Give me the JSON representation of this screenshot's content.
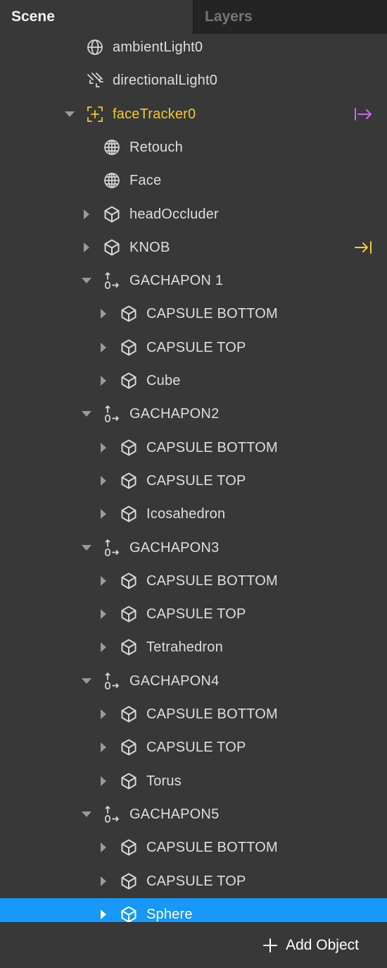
{
  "tabs": {
    "scene": "Scene",
    "layers": "Layers"
  },
  "tree": [
    {
      "label": "ambientLight0",
      "icon": "ambient-light-icon",
      "depth": 2,
      "expander": "none"
    },
    {
      "label": "directionalLight0",
      "icon": "directional-light-icon",
      "depth": 2,
      "expander": "none"
    },
    {
      "label": "faceTracker0",
      "icon": "face-tracker-icon",
      "depth": 2,
      "expander": "expanded",
      "accent": "yellow",
      "badge": "patch-out-icon",
      "badge_color": "#c86ae0"
    },
    {
      "label": "Retouch",
      "icon": "mesh-icon",
      "depth": 3,
      "expander": "none"
    },
    {
      "label": "Face",
      "icon": "mesh-icon",
      "depth": 3,
      "expander": "none"
    },
    {
      "label": "headOccluder",
      "icon": "cube-icon",
      "depth": 3,
      "expander": "collapsed"
    },
    {
      "label": "KNOB",
      "icon": "cube-icon",
      "depth": 3,
      "expander": "collapsed",
      "badge": "patch-in-icon",
      "badge_color": "#f4c63d"
    },
    {
      "label": "GACHAPON 1",
      "icon": "null-object-icon",
      "depth": 3,
      "expander": "expanded"
    },
    {
      "label": "CAPSULE BOTTOM",
      "icon": "cube-icon",
      "depth": 4,
      "expander": "collapsed"
    },
    {
      "label": "CAPSULE TOP",
      "icon": "cube-icon",
      "depth": 4,
      "expander": "collapsed"
    },
    {
      "label": "Cube",
      "icon": "cube-icon",
      "depth": 4,
      "expander": "collapsed"
    },
    {
      "label": "GACHAPON2",
      "icon": "null-object-icon",
      "depth": 3,
      "expander": "expanded"
    },
    {
      "label": "CAPSULE BOTTOM",
      "icon": "cube-icon",
      "depth": 4,
      "expander": "collapsed"
    },
    {
      "label": "CAPSULE TOP",
      "icon": "cube-icon",
      "depth": 4,
      "expander": "collapsed"
    },
    {
      "label": "Icosahedron",
      "icon": "cube-icon",
      "depth": 4,
      "expander": "collapsed"
    },
    {
      "label": "GACHAPON3",
      "icon": "null-object-icon",
      "depth": 3,
      "expander": "expanded"
    },
    {
      "label": "CAPSULE BOTTOM",
      "icon": "cube-icon",
      "depth": 4,
      "expander": "collapsed"
    },
    {
      "label": "CAPSULE TOP",
      "icon": "cube-icon",
      "depth": 4,
      "expander": "collapsed"
    },
    {
      "label": "Tetrahedron",
      "icon": "cube-icon",
      "depth": 4,
      "expander": "collapsed"
    },
    {
      "label": "GACHAPON4",
      "icon": "null-object-icon",
      "depth": 3,
      "expander": "expanded"
    },
    {
      "label": "CAPSULE BOTTOM",
      "icon": "cube-icon",
      "depth": 4,
      "expander": "collapsed"
    },
    {
      "label": "CAPSULE TOP",
      "icon": "cube-icon",
      "depth": 4,
      "expander": "collapsed"
    },
    {
      "label": "Torus",
      "icon": "cube-icon",
      "depth": 4,
      "expander": "collapsed"
    },
    {
      "label": "GACHAPON5",
      "icon": "null-object-icon",
      "depth": 3,
      "expander": "expanded"
    },
    {
      "label": "CAPSULE BOTTOM",
      "icon": "cube-icon",
      "depth": 4,
      "expander": "collapsed"
    },
    {
      "label": "CAPSULE TOP",
      "icon": "cube-icon",
      "depth": 4,
      "expander": "collapsed"
    },
    {
      "label": "Sphere",
      "icon": "cube-icon",
      "depth": 4,
      "expander": "collapsed",
      "selected": true
    }
  ],
  "footer": {
    "add_object_label": "Add Object"
  },
  "colors": {
    "panel": "#383838",
    "tab_bar": "#242424",
    "selection": "#1797f7",
    "tracker_yellow": "#f4c63d",
    "text": "#dedede"
  }
}
